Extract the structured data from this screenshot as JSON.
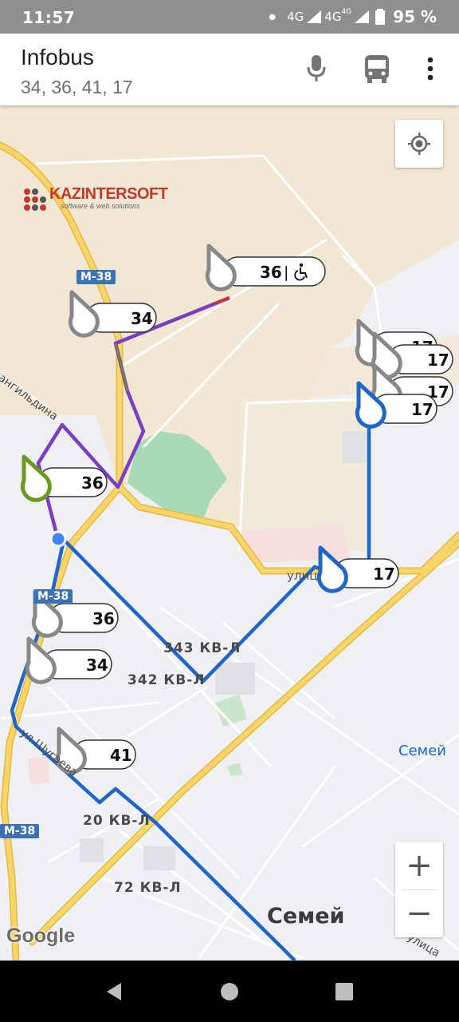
{
  "status_bar": {
    "time": "11:57",
    "network_1": "4G",
    "network_2": "4G",
    "network_2_small": "4G",
    "battery": "95 %"
  },
  "app_bar": {
    "title": "Infobus",
    "subtitle": "34, 36, 41, 17"
  },
  "icons": {
    "mic": "microphone-icon",
    "bus": "bus-icon",
    "menu": "more-vert-icon",
    "locate": "my-location-icon",
    "accessible": "wheelchair-icon"
  },
  "map": {
    "logo_name": "KAZINTERSOFT",
    "logo_tagline": "software & web solutions",
    "road_shields": [
      "M-38",
      "M-38",
      "M-38"
    ],
    "place_labels": {
      "street_zhangildina": "жангильдина",
      "street_ulits": "улиц",
      "street_shugaeva": "ул.Шугаева",
      "street_ulitsa_right": "улица",
      "kvl_343": "343 КВ-Л",
      "kvl_342": "342 КВ-Л",
      "kvl_20": "20 КВ-Л",
      "kvl_72": "72 КВ-Л",
      "city_semey": "Семей",
      "city_semey_right": "Семей"
    },
    "google_logo": "Google",
    "colors": {
      "route_36": "#7a3ec2",
      "route_17": "#1f66c8",
      "road_major": "#f6c94b",
      "park": "#a8dab5"
    },
    "bus_markers": [
      {
        "route": "36",
        "accessible": true,
        "color": "#888888"
      },
      {
        "route": "34",
        "accessible": false,
        "color": "#888888"
      },
      {
        "route": "17",
        "accessible": false,
        "color": "#888888"
      },
      {
        "route": "17",
        "accessible": false,
        "color": "#888888"
      },
      {
        "route": "17",
        "accessible": false,
        "color": "#888888"
      },
      {
        "route": "17",
        "accessible": false,
        "color": "#1f66c8"
      },
      {
        "route": "36",
        "accessible": false,
        "color": "#6a9a1d"
      },
      {
        "route": "17",
        "accessible": false,
        "color": "#1f66c8"
      },
      {
        "route": "36",
        "accessible": false,
        "color": "#888888"
      },
      {
        "route": "34",
        "accessible": false,
        "color": "#888888"
      },
      {
        "route": "41",
        "accessible": false,
        "color": "#888888"
      }
    ],
    "accessible_separator": "|",
    "zoom_in": "+",
    "zoom_out": "−"
  }
}
